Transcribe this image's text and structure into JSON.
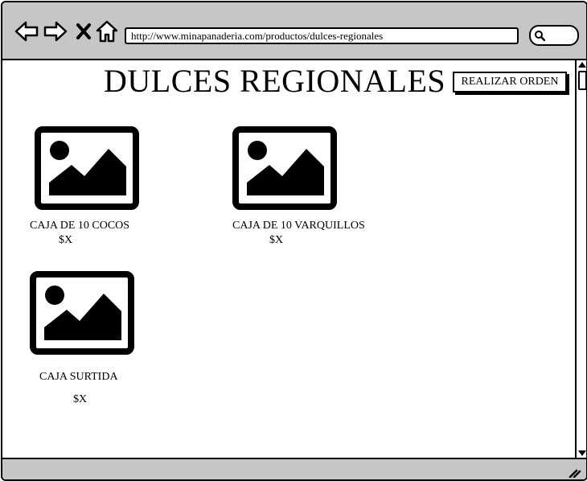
{
  "browser": {
    "url": "http://www.minapanaderia.com/productos/dulces-regionales",
    "icons": [
      "back-arrow-icon",
      "forward-arrow-icon",
      "close-icon",
      "home-icon",
      "search-icon"
    ]
  },
  "page": {
    "title": "DULCES REGIONALES",
    "order_button": "REALIZAR ORDEN"
  },
  "products": [
    {
      "name": "CAJA DE 10 COCOS",
      "price": "$X"
    },
    {
      "name": "CAJA DE 10 VARQUILLOS",
      "price": "$X"
    },
    {
      "name": "CAJA SURTIDA",
      "price": "$X"
    }
  ]
}
